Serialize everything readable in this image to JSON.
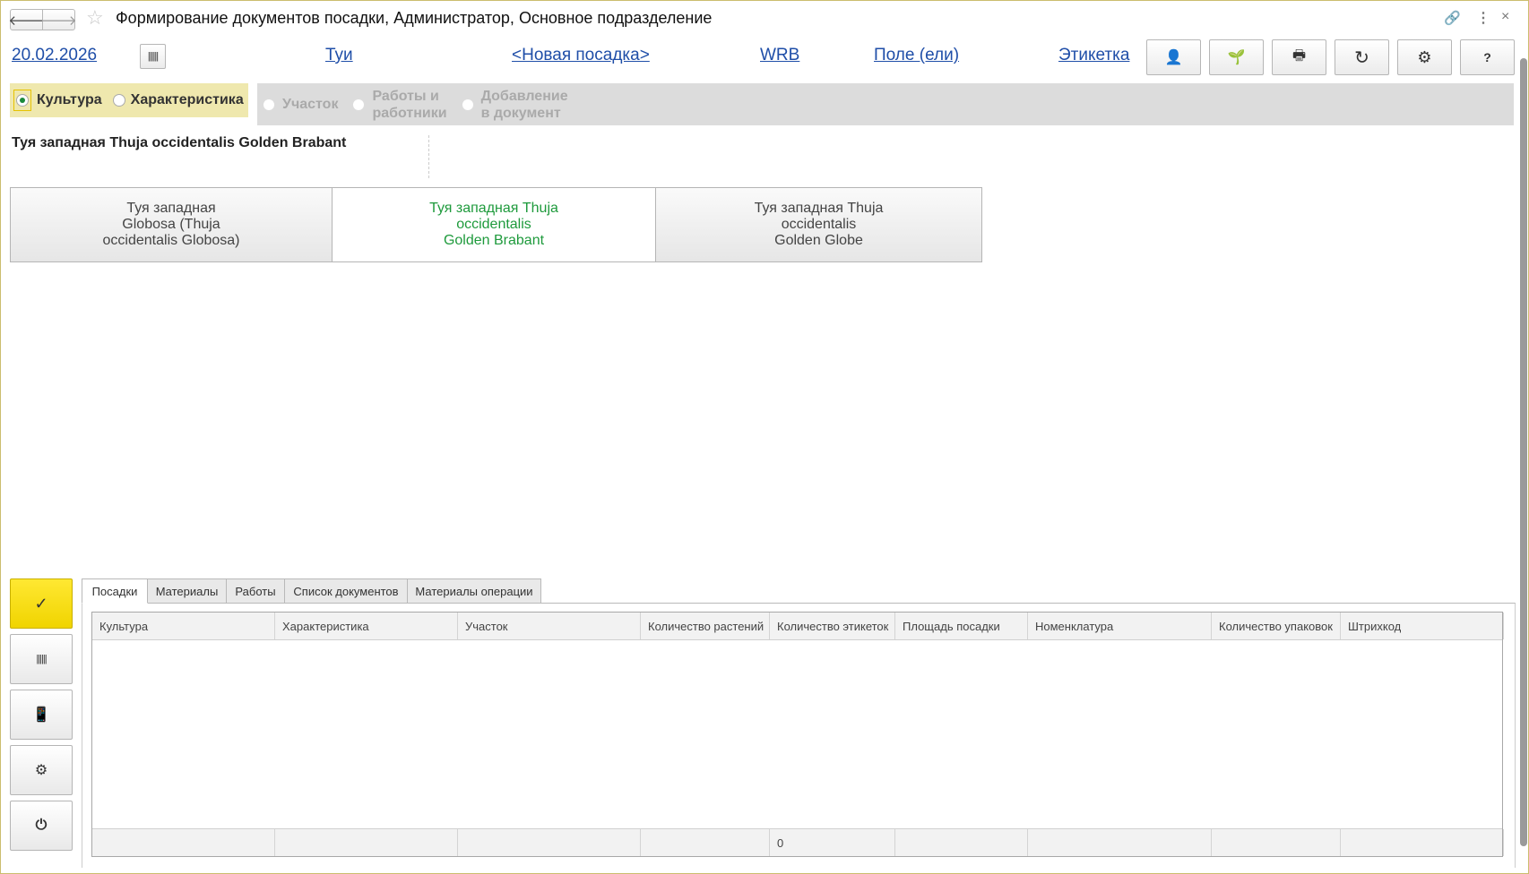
{
  "window": {
    "title": "Формирование документов посадки, Администратор, Основное подразделение"
  },
  "toolbar": {
    "date": "20.02.2026",
    "culture_link": "Туи",
    "planting_link": "<Новая посадка>",
    "wrb_link": "WRB",
    "field_link": "Поле (ели)",
    "label_link": "Этикетка",
    "help": "?"
  },
  "steps": [
    {
      "label": "Культура",
      "selected": true
    },
    {
      "label": "Характеристика",
      "selected": false
    },
    {
      "label": "Участок"
    },
    {
      "label": "Работы и\nработники"
    },
    {
      "label": "Добавление\nв документ"
    }
  ],
  "selected_heading": "Туя западная Thuja occidentalis Golden Brabant",
  "cards": [
    {
      "label": "Туя западная\nGlobosa (Thuja\noccidentalis Globosa)"
    },
    {
      "label": "Туя западная Thuja\noccidentalis\nGolden Brabant",
      "selected": true
    },
    {
      "label": "Туя западная Thuja\noccidentalis\nGolden Globe"
    }
  ],
  "tabs": [
    "Посадки",
    "Материалы",
    "Работы",
    "Список документов",
    "Материалы операции"
  ],
  "table": {
    "columns": [
      "Культура",
      "Характеристика",
      "Участок",
      "Количество растений",
      "Количество этикеток",
      "Площадь посадки",
      "Номенклатура",
      "Количество упаковок",
      "Штрихкод"
    ],
    "footer": [
      "",
      "",
      "",
      "",
      "0",
      "",
      "",
      "",
      ""
    ]
  },
  "colors": {
    "link": "#1f4ea8",
    "accent_yellow": "#ffe100",
    "selected_green": "#1e9a3c"
  }
}
